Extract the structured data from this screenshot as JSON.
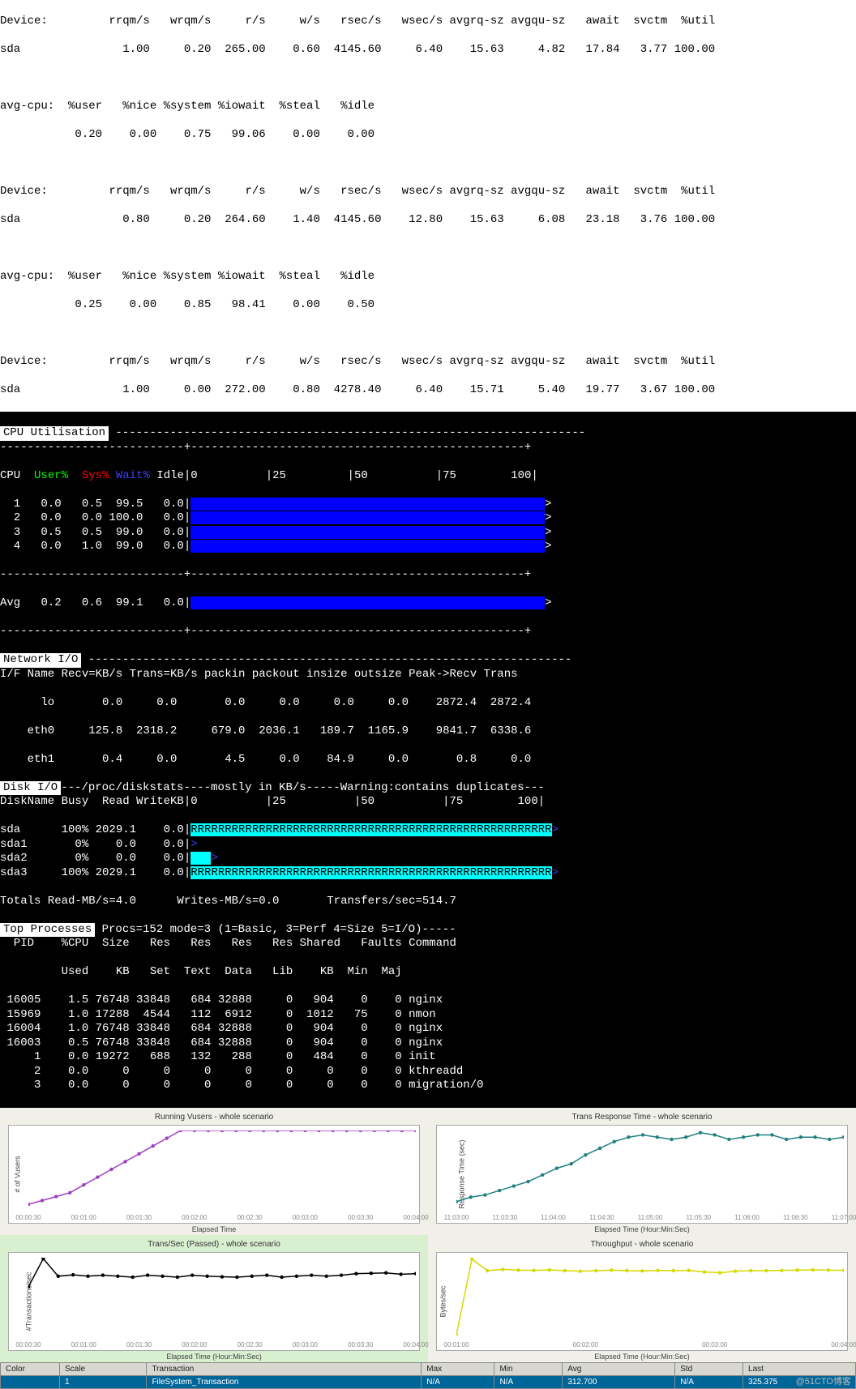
{
  "iostat": {
    "blocks": [
      {
        "dev_hdr": "Device:         rrqm/s   wrqm/s     r/s     w/s   rsec/s   wsec/s avgrq-sz avgqu-sz   await  svctm  %util",
        "dev_row": "sda               1.00     0.20  265.00    0.60  4145.60     6.40    15.63     4.82   17.84   3.77 100.00",
        "cpu_hdr": "avg-cpu:  %user   %nice %system %iowait  %steal   %idle",
        "cpu_row": "           0.20    0.00    0.75   99.06    0.00    0.00"
      },
      {
        "dev_hdr": "Device:         rrqm/s   wrqm/s     r/s     w/s   rsec/s   wsec/s avgrq-sz avgqu-sz   await  svctm  %util",
        "dev_row": "sda               0.80     0.20  264.60    1.40  4145.60    12.80    15.63     6.08   23.18   3.76 100.00",
        "cpu_hdr": "avg-cpu:  %user   %nice %system %iowait  %steal   %idle",
        "cpu_row": "           0.25    0.00    0.85   98.41    0.00    0.50"
      },
      {
        "dev_hdr": "Device:         rrqm/s   wrqm/s     r/s     w/s   rsec/s   wsec/s avgrq-sz avgqu-sz   await  svctm  %util",
        "dev_row": "sda               1.00     0.00  272.00    0.80  4278.40     6.40    15.71     5.40   19.77   3.67 100.00"
      }
    ]
  },
  "nmon": {
    "sections": {
      "cpu": "CPU Utilisation",
      "net": "Network I/O",
      "disk": "Disk I/O",
      "top": "Top Processes"
    },
    "cpu": {
      "hdr_lbls": {
        "cpu": "CPU",
        "user": "User%",
        "sys": "Sys%",
        "wait": "Wait%",
        "idle": "Idle"
      },
      "scale": "|0          |25         |50          |75        100|",
      "rows": [
        {
          "cpu": "1",
          "user": "0.0",
          "sys": "0.5",
          "wait": "99.5",
          "idle": "0.0"
        },
        {
          "cpu": "2",
          "user": "0.0",
          "sys": "0.0",
          "wait": "100.0",
          "idle": "0.0"
        },
        {
          "cpu": "3",
          "user": "0.5",
          "sys": "0.5",
          "wait": "99.0",
          "idle": "0.0"
        },
        {
          "cpu": "4",
          "user": "0.0",
          "sys": "1.0",
          "wait": "99.0",
          "idle": "0.0"
        }
      ],
      "avg": {
        "cpu": "Avg",
        "user": "0.2",
        "sys": "0.6",
        "wait": "99.1",
        "idle": "0.0"
      }
    },
    "net": {
      "hdr": "I/F Name Recv=KB/s Trans=KB/s packin packout insize outsize Peak->Recv Trans",
      "rows": [
        "      lo       0.0     0.0       0.0     0.0     0.0     0.0    2872.4  2872.4",
        "    eth0     125.8  2318.2     679.0  2036.1   189.7  1165.9    9841.7  6338.6",
        "    eth1       0.4     0.0       4.5     0.0    84.9     0.0       0.8     0.0"
      ]
    },
    "disk": {
      "hdrline": "/proc/diskstats----mostly in KB/s-----Warning:contains duplicates---",
      "colhdr": "DiskName Busy  Read WriteKB",
      "scale": "|0          |25          |50          |75        100|",
      "rows": [
        {
          "name": "sda ",
          "busy": "100%",
          "read": "2029.1",
          "write": "0.0",
          "bar": "RRRRRRRRRRRRRRRRRRRRRRRRRRRRRRRRRRRRRRRRRRRRRRRRRRRRR",
          "gt": ">"
        },
        {
          "name": "sda1",
          "busy": "  0%",
          "read": "   0.0",
          "write": "0.0",
          "bar": "",
          "gt": ">"
        },
        {
          "name": "sda2",
          "busy": "  0%",
          "read": "   0.0",
          "write": "0.0",
          "bar": "   ",
          "gt": ">"
        },
        {
          "name": "sda3",
          "busy": "100%",
          "read": "2029.1",
          "write": "0.0",
          "bar": "RRRRRRRRRRRRRRRRRRRRRRRRRRRRRRRRRRRRRRRRRRRRRRRRRRRRR",
          "gt": ">"
        }
      ],
      "totals": "Totals Read-MB/s=4.0      Writes-MB/s=0.0       Transfers/sec=514.7"
    },
    "top": {
      "info": "Procs=152 mode=3 (1=Basic, 3=Perf 4=Size 5=I/O)-----",
      "hdr1": "  PID    %CPU  Size   Res   Res   Res   Res Shared   Faults Command",
      "hdr2": "         Used    KB   Set  Text  Data   Lib    KB  Min  Maj",
      "rows": [
        " 16005    1.5 76748 33848   684 32888     0   904    0    0 nginx",
        " 15969    1.0 17288  4544   112  6912     0  1012   75    0 nmon",
        " 16004    1.0 76748 33848   684 32888     0   904    0    0 nginx",
        " 16003    0.5 76748 33848   684 32888     0   904    0    0 nginx",
        "     1    0.0 19272   688   132   288     0   484    0    0 init",
        "     2    0.0     0     0     0     0     0     0    0    0 kthreadd",
        "     3    0.0     0     0     0     0     0     0    0    0 migration/0"
      ]
    }
  },
  "chart_data": [
    {
      "type": "line",
      "title": "Running Vusers - whole scenario",
      "xlabel": "Elapsed Time",
      "ylabel": "# of Vusers",
      "ylim": [
        0,
        100
      ],
      "x": [
        "00:00:30",
        "00:01:00",
        "00:01:30",
        "00:02:00",
        "00:02:30",
        "00:03:00",
        "00:03:30",
        "00:04:00"
      ],
      "series": [
        {
          "name": "Vusers",
          "color": "#a040c0",
          "values": [
            5,
            10,
            15,
            20,
            30,
            40,
            50,
            60,
            70,
            80,
            90,
            100,
            100,
            100,
            100,
            100,
            100,
            100,
            100,
            100,
            100,
            100,
            100,
            100,
            100,
            100,
            100,
            100,
            100
          ]
        }
      ]
    },
    {
      "type": "line",
      "title": "Trans Response Time - whole scenario",
      "xlabel": "Elapsed Time (Hour:Min:Sec)",
      "ylabel": "Response Time (sec)",
      "ylim": [
        0,
        0.35
      ],
      "x": [
        "11:03:00",
        "11:03:30",
        "11:04:00",
        "11:04:30",
        "11:05:00",
        "11:05:30",
        "11:06:00",
        "11:06:30",
        "11:07:00"
      ],
      "series": [
        {
          "name": "FileSystem_Transaction",
          "color": "#208080",
          "values": [
            0.03,
            0.05,
            0.06,
            0.08,
            0.1,
            0.12,
            0.15,
            0.18,
            0.2,
            0.24,
            0.27,
            0.3,
            0.32,
            0.33,
            0.32,
            0.31,
            0.32,
            0.34,
            0.33,
            0.31,
            0.32,
            0.33,
            0.33,
            0.31,
            0.32,
            0.32,
            0.31,
            0.32
          ]
        }
      ]
    },
    {
      "type": "line",
      "title": "Trans/Sec (Passed) - whole scenario",
      "xlabel": "Elapsed Time (Hour:Min:Sec)",
      "ylabel": "#Transactions/sec",
      "ylim": [
        0,
        400
      ],
      "x": [
        "00:00:30",
        "00:01:00",
        "00:01:30",
        "00:02:00",
        "00:02:30",
        "00:03:00",
        "00:03:30",
        "00:04:00"
      ],
      "series": [
        {
          "name": "FileSystem_Transaction",
          "color": "#000000",
          "values": [
            250,
            395,
            305,
            312,
            305,
            310,
            305,
            300,
            310,
            305,
            300,
            310,
            305,
            302,
            300,
            305,
            310,
            300,
            305,
            310,
            305,
            310,
            318,
            320,
            322,
            315,
            318
          ]
        }
      ]
    },
    {
      "type": "line",
      "title": "Throughput - whole scenario",
      "xlabel": "Elapsed Time (Hour:Min:Sec)",
      "ylabel": "Bytes/sec",
      "ylim": [
        0,
        3000000
      ],
      "x": [
        "00:01:00",
        "00:02:00",
        "00:03:00",
        "00:04:00"
      ],
      "series": [
        {
          "name": "Throughput",
          "color": "#d8d800",
          "values": [
            20000,
            2950000,
            2500000,
            2550000,
            2520000,
            2510000,
            2530000,
            2500000,
            2480000,
            2500000,
            2520000,
            2500000,
            2490000,
            2510000,
            2500000,
            2510000,
            2450000,
            2420000,
            2480000,
            2500000,
            2500000,
            2510000,
            2520000,
            2530000,
            2520000,
            2510000
          ]
        }
      ]
    }
  ],
  "legend": {
    "headers": [
      "Color",
      "Scale",
      "Transaction",
      "Max",
      "Min",
      "Avg",
      "Std",
      "Last"
    ],
    "row": {
      "scale": "1",
      "transaction": "FileSystem_Transaction",
      "max": "N/A",
      "min": "N/A",
      "avg": "312.700",
      "std": "N/A",
      "last": "325.375"
    }
  },
  "watermark": "@51CTO博客"
}
